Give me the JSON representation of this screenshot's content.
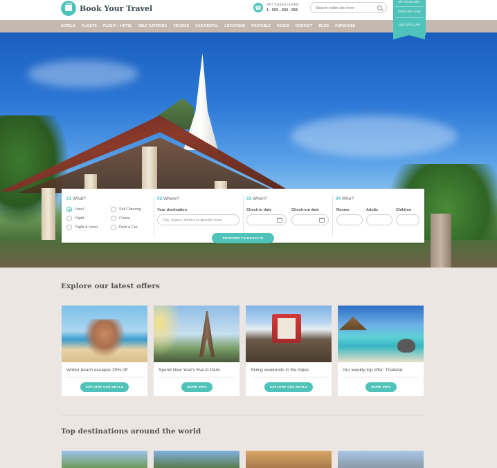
{
  "header": {
    "logo_text": "Book Your Travel",
    "support_label": "24/7 Support number",
    "support_number": "1 - 555 - 555 - 555",
    "search_placeholder": "Search entire site here",
    "ribbon": [
      "MY ACCOUNT",
      "ENGLISH (US)",
      "USD DOLLAR"
    ]
  },
  "nav": {
    "items": [
      "HOTELS",
      "FLIGHTS",
      "FLIGHT + HOTEL",
      "SELF CATERING",
      "CRUISES",
      "CAR RENTAL",
      "LOCATIONS",
      "POSTABLE",
      "PAGES",
      "CONTACT",
      "BLOG",
      "PURCHASE"
    ]
  },
  "booking": {
    "what": {
      "num": "01",
      "title": "What?",
      "options": [
        "Hotel",
        "Self Catering",
        "Flight",
        "Cruise",
        "Flight & Hotel",
        "Rent a Car"
      ],
      "selected": "Hotel"
    },
    "where": {
      "num": "02",
      "title": "Where?",
      "label": "Your destination",
      "placeholder": "City, region, district or specific hotel"
    },
    "when": {
      "num": "03",
      "title": "When?",
      "checkin_label": "Check-in date",
      "checkout_label": "Check-out date"
    },
    "who": {
      "num": "04",
      "title": "Who?",
      "rooms_label": "Rooms",
      "adults_label": "Adults",
      "children_label": "Children"
    },
    "proceed_label": "PROCEED TO RESULTS"
  },
  "offers": {
    "title": "Explore our latest offers",
    "cards": [
      {
        "title": "Winter beach escapes 30% off",
        "button": "EXPLORE OUR DEALS"
      },
      {
        "title": "Spend New Year's Eve in Paris",
        "button": "MORE INFO"
      },
      {
        "title": "Skiing weekends in the Alpes",
        "button": "EXPLORE OUR DEALS"
      },
      {
        "title": "Our weekly top offer: Thailand",
        "button": "MORE INFO"
      }
    ]
  },
  "destinations": {
    "title": "Top destinations around the world"
  },
  "colors": {
    "accent": "#4fc3b9",
    "nav_bg": "#c5b8ae",
    "page_bg": "#ece6e2"
  }
}
